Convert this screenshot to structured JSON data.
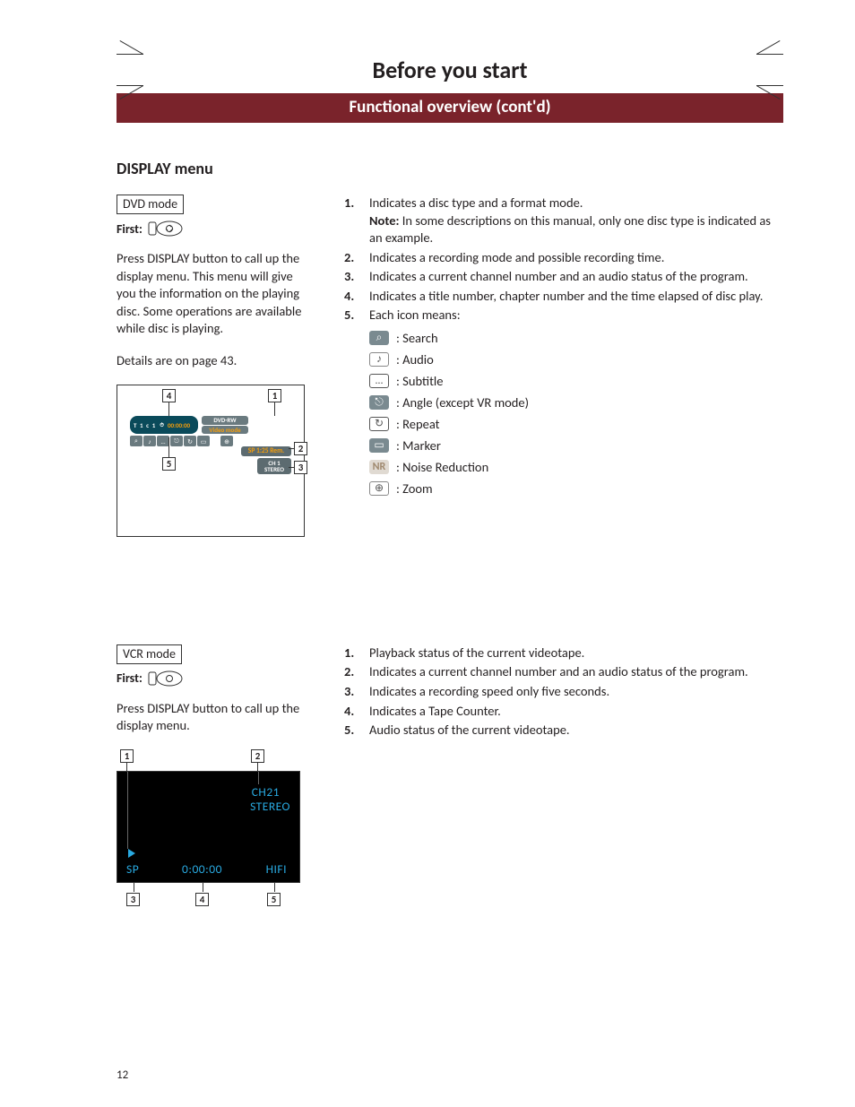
{
  "banner": {
    "title": "Before you start",
    "subtitle": "Functional overview (cont'd)"
  },
  "section_title": "DISPLAY menu",
  "dvd": {
    "mode_label": "DVD mode",
    "first_label": "First:",
    "para": "Press DISPLAY button to call up the display menu. This menu will give you the information on the playing disc. Some operations are available while disc is playing.",
    "details": "Details are on page 43.",
    "figure": {
      "toprow": "T   1   c   1",
      "time": "00:00:00",
      "side_top": "DVD-RW",
      "side_mid": "Video mode",
      "sp": "SP 1:25 Rem.",
      "ch": "CH 1",
      "stereo": "STEREO",
      "callouts": {
        "c1": "1",
        "c2": "2",
        "c3": "3",
        "c4": "4",
        "c5": "5"
      }
    },
    "list": [
      {
        "num": "1.",
        "txt_a": "Indicates a disc type and a format mode.",
        "note_label": "Note:",
        "note_txt": " In some descriptions on this manual, only one disc type is indicated as an example."
      },
      {
        "num": "2.",
        "txt": "Indicates a recording mode and possible recording time."
      },
      {
        "num": "3.",
        "txt": "Indicates a current channel number and an audio status of the program."
      },
      {
        "num": "4.",
        "txt": "Indicates a title number, chapter number and the time elapsed of disc play."
      },
      {
        "num": "5.",
        "txt": "Each icon means:"
      }
    ],
    "icons": [
      {
        "label": ": Search",
        "cls": "g-search",
        "sym": "⌕"
      },
      {
        "label": ": Audio",
        "cls": "g-audio",
        "sym": "♪"
      },
      {
        "label": ": Subtitle",
        "cls": "g-subtitle",
        "sym": "…"
      },
      {
        "label": ": Angle (except VR mode)",
        "cls": "g-angle",
        "sym": "⎋"
      },
      {
        "label": ": Repeat",
        "cls": "g-repeat",
        "sym": "↻"
      },
      {
        "label": ": Marker",
        "cls": "g-marker",
        "sym": "▭"
      },
      {
        "label": ": Noise Reduction",
        "cls": "g-nr",
        "sym": "NR"
      },
      {
        "label": ": Zoom",
        "cls": "g-zoom",
        "sym": "⊕"
      }
    ]
  },
  "vcr": {
    "mode_label": "VCR mode",
    "first_label": "First:",
    "para": "Press DISPLAY button to call up the display menu.",
    "figure": {
      "ch": "CH21",
      "stereo": "STEREO",
      "sp": "SP",
      "counter": "0:00:00",
      "hifi": "HIFI",
      "callouts": {
        "c1": "1",
        "c2": "2",
        "c3": "3",
        "c4": "4",
        "c5": "5"
      }
    },
    "list": [
      {
        "num": "1.",
        "txt": "Playback status of the current videotape."
      },
      {
        "num": "2.",
        "txt": "Indicates a current channel number and an audio status of the program."
      },
      {
        "num": "3.",
        "txt": "Indicates a recording speed only five seconds."
      },
      {
        "num": "4.",
        "txt": "Indicates a Tape Counter."
      },
      {
        "num": "5.",
        "txt": "Audio status of the current videotape."
      }
    ]
  },
  "page_number": "12"
}
